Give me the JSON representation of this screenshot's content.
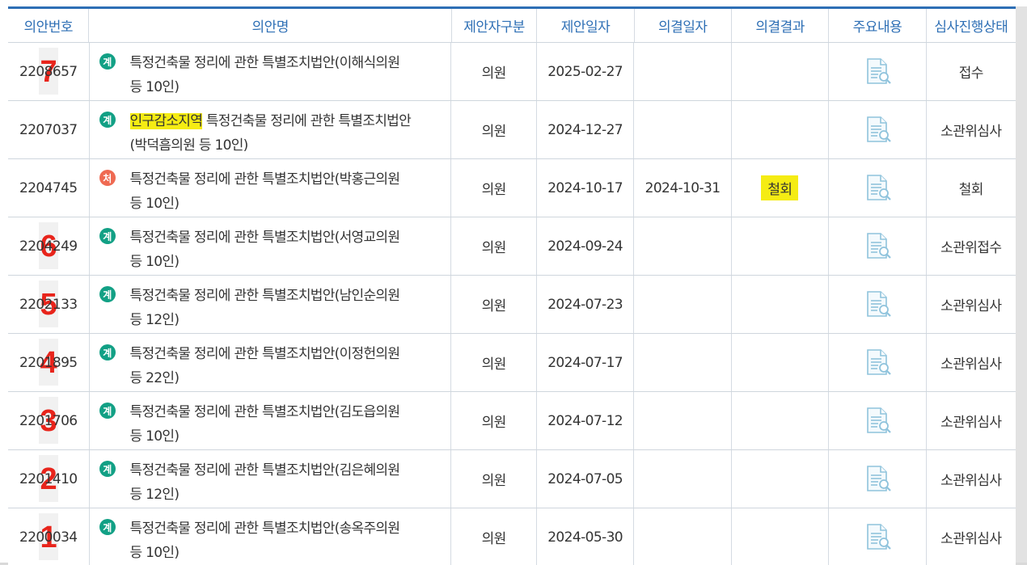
{
  "columns": [
    "의안번호",
    "의안명",
    "제안자구분",
    "제안일자",
    "의결일자",
    "의결결과",
    "주요내용",
    "심사진행상태"
  ],
  "rows": [
    {
      "bill_no": "2208657",
      "marker": "7",
      "badge": "계",
      "badge_color": "green",
      "title_hl": "",
      "title": "특정건축물 정리에 관한 특별조치법안(이해식의원",
      "title_line2": "등 10인)",
      "proposer": "의원",
      "proposed_date": "2025-02-27",
      "decision_date": "",
      "result": "",
      "status": "접수"
    },
    {
      "bill_no": "2207037",
      "marker": "",
      "badge": "계",
      "badge_color": "green",
      "title_hl": "인구감소지역",
      "title": " 특정건축물 정리에 관한 특별조치법안",
      "title_line2": "(박덕흠의원 등 10인)",
      "proposer": "의원",
      "proposed_date": "2024-12-27",
      "decision_date": "",
      "result": "",
      "status": "소관위심사"
    },
    {
      "bill_no": "2204745",
      "marker": "",
      "badge": "처",
      "badge_color": "red",
      "title_hl": "",
      "title": "특정건축물 정리에 관한 특별조치법안(박홍근의원",
      "title_line2": "등 10인)",
      "proposer": "의원",
      "proposed_date": "2024-10-17",
      "decision_date": "2024-10-31",
      "result": "철회",
      "status": "철회"
    },
    {
      "bill_no": "2204249",
      "marker": "6",
      "badge": "계",
      "badge_color": "green",
      "title_hl": "",
      "title": "특정건축물 정리에 관한 특별조치법안(서영교의원",
      "title_line2": "등 10인)",
      "proposer": "의원",
      "proposed_date": "2024-09-24",
      "decision_date": "",
      "result": "",
      "status": "소관위접수"
    },
    {
      "bill_no": "2202133",
      "marker": "5",
      "badge": "계",
      "badge_color": "green",
      "title_hl": "",
      "title": "특정건축물 정리에 관한 특별조치법안(남인순의원",
      "title_line2": "등 12인)",
      "proposer": "의원",
      "proposed_date": "2024-07-23",
      "decision_date": "",
      "result": "",
      "status": "소관위심사"
    },
    {
      "bill_no": "2201895",
      "marker": "4",
      "badge": "계",
      "badge_color": "green",
      "title_hl": "",
      "title": "특정건축물 정리에 관한 특별조치법안(이정헌의원",
      "title_line2": "등 22인)",
      "proposer": "의원",
      "proposed_date": "2024-07-17",
      "decision_date": "",
      "result": "",
      "status": "소관위심사"
    },
    {
      "bill_no": "2201706",
      "marker": "3",
      "badge": "계",
      "badge_color": "green",
      "title_hl": "",
      "title": "특정건축물 정리에 관한 특별조치법안(김도읍의원",
      "title_line2": "등 10인)",
      "proposer": "의원",
      "proposed_date": "2024-07-12",
      "decision_date": "",
      "result": "",
      "status": "소관위심사"
    },
    {
      "bill_no": "2201410",
      "marker": "2",
      "badge": "계",
      "badge_color": "green",
      "title_hl": "",
      "title": "특정건축물 정리에 관한 특별조치법안(김은혜의원",
      "title_line2": "등 12인)",
      "proposer": "의원",
      "proposed_date": "2024-07-05",
      "decision_date": "",
      "result": "",
      "status": "소관위심사"
    },
    {
      "bill_no": "2200034",
      "marker": "1",
      "badge": "계",
      "badge_color": "green",
      "title_hl": "",
      "title": "특정건축물 정리에 관한 특별조치법안(송옥주의원",
      "title_line2": "등 10인)",
      "proposer": "의원",
      "proposed_date": "2024-05-30",
      "decision_date": "",
      "result": "",
      "status": "소관위심사"
    }
  ],
  "colors": {
    "header_text": "#2e6fb5",
    "accent_bar": "#2e6fb5",
    "badge_green": "#12a085",
    "badge_red": "#ef6a52",
    "highlight": "#f5ec13",
    "marker": "#e8241b",
    "doc_icon": "#8fc3dc"
  },
  "icons": {
    "summary": "document-search-icon"
  }
}
